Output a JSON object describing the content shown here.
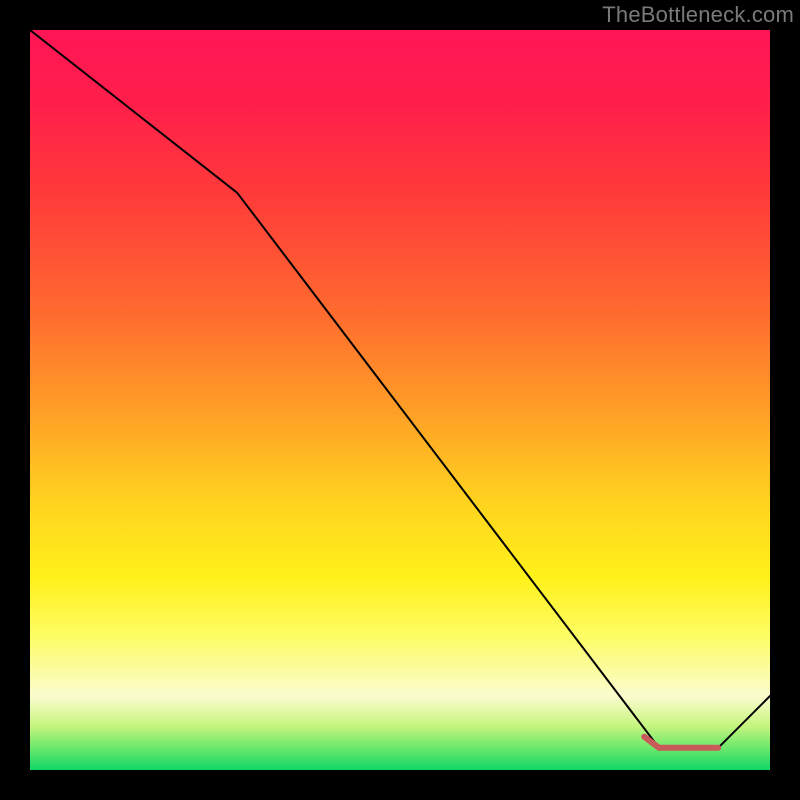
{
  "watermark": "TheBottleneck.com",
  "chart_data": {
    "type": "line",
    "title": "",
    "xlabel": "",
    "ylabel": "",
    "xlim": [
      0,
      100
    ],
    "ylim": [
      0,
      100
    ],
    "grid": false,
    "series": [
      {
        "name": "black-line",
        "color": "#000000",
        "points": [
          {
            "x": 0,
            "y": 100
          },
          {
            "x": 28,
            "y": 78
          },
          {
            "x": 85,
            "y": 3
          },
          {
            "x": 93,
            "y": 3
          },
          {
            "x": 100,
            "y": 10
          }
        ]
      },
      {
        "name": "red-segment",
        "color": "#c85a5a",
        "stroke_width": 6,
        "points": [
          {
            "x": 83,
            "y": 4.5
          },
          {
            "x": 85,
            "y": 3
          },
          {
            "x": 93,
            "y": 3
          }
        ]
      }
    ],
    "background_gradient": {
      "direction": "vertical",
      "stops": [
        {
          "pos": 0.0,
          "color": "#ff1556"
        },
        {
          "pos": 0.22,
          "color": "#ff3a3a"
        },
        {
          "pos": 0.52,
          "color": "#ffa126"
        },
        {
          "pos": 0.74,
          "color": "#fff11a"
        },
        {
          "pos": 0.9,
          "color": "#fbfccf"
        },
        {
          "pos": 1.0,
          "color": "#0fd668"
        }
      ]
    }
  }
}
